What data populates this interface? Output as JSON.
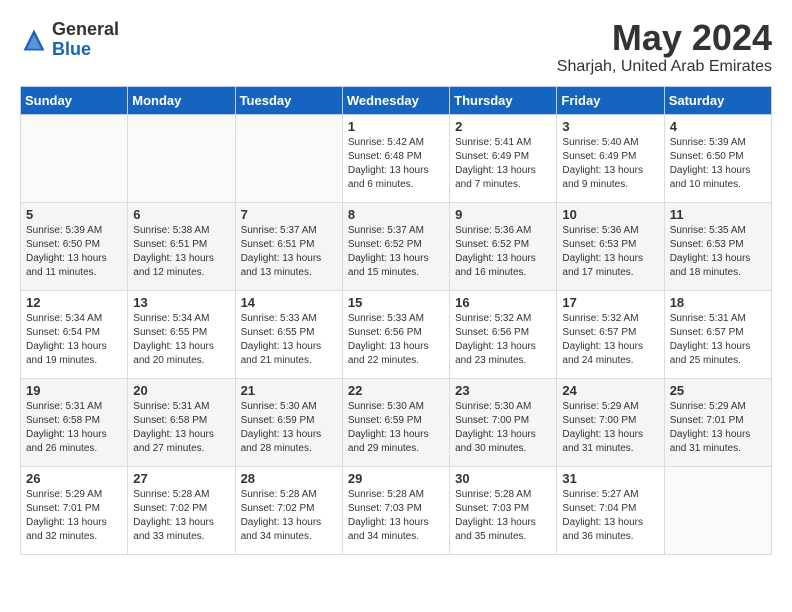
{
  "header": {
    "logo_general": "General",
    "logo_blue": "Blue",
    "month_year": "May 2024",
    "location": "Sharjah, United Arab Emirates"
  },
  "weekdays": [
    "Sunday",
    "Monday",
    "Tuesday",
    "Wednesday",
    "Thursday",
    "Friday",
    "Saturday"
  ],
  "weeks": [
    [
      {
        "day": "",
        "info": ""
      },
      {
        "day": "",
        "info": ""
      },
      {
        "day": "",
        "info": ""
      },
      {
        "day": "1",
        "info": "Sunrise: 5:42 AM\nSunset: 6:48 PM\nDaylight: 13 hours\nand 6 minutes."
      },
      {
        "day": "2",
        "info": "Sunrise: 5:41 AM\nSunset: 6:49 PM\nDaylight: 13 hours\nand 7 minutes."
      },
      {
        "day": "3",
        "info": "Sunrise: 5:40 AM\nSunset: 6:49 PM\nDaylight: 13 hours\nand 9 minutes."
      },
      {
        "day": "4",
        "info": "Sunrise: 5:39 AM\nSunset: 6:50 PM\nDaylight: 13 hours\nand 10 minutes."
      }
    ],
    [
      {
        "day": "5",
        "info": "Sunrise: 5:39 AM\nSunset: 6:50 PM\nDaylight: 13 hours\nand 11 minutes."
      },
      {
        "day": "6",
        "info": "Sunrise: 5:38 AM\nSunset: 6:51 PM\nDaylight: 13 hours\nand 12 minutes."
      },
      {
        "day": "7",
        "info": "Sunrise: 5:37 AM\nSunset: 6:51 PM\nDaylight: 13 hours\nand 13 minutes."
      },
      {
        "day": "8",
        "info": "Sunrise: 5:37 AM\nSunset: 6:52 PM\nDaylight: 13 hours\nand 15 minutes."
      },
      {
        "day": "9",
        "info": "Sunrise: 5:36 AM\nSunset: 6:52 PM\nDaylight: 13 hours\nand 16 minutes."
      },
      {
        "day": "10",
        "info": "Sunrise: 5:36 AM\nSunset: 6:53 PM\nDaylight: 13 hours\nand 17 minutes."
      },
      {
        "day": "11",
        "info": "Sunrise: 5:35 AM\nSunset: 6:53 PM\nDaylight: 13 hours\nand 18 minutes."
      }
    ],
    [
      {
        "day": "12",
        "info": "Sunrise: 5:34 AM\nSunset: 6:54 PM\nDaylight: 13 hours\nand 19 minutes."
      },
      {
        "day": "13",
        "info": "Sunrise: 5:34 AM\nSunset: 6:55 PM\nDaylight: 13 hours\nand 20 minutes."
      },
      {
        "day": "14",
        "info": "Sunrise: 5:33 AM\nSunset: 6:55 PM\nDaylight: 13 hours\nand 21 minutes."
      },
      {
        "day": "15",
        "info": "Sunrise: 5:33 AM\nSunset: 6:56 PM\nDaylight: 13 hours\nand 22 minutes."
      },
      {
        "day": "16",
        "info": "Sunrise: 5:32 AM\nSunset: 6:56 PM\nDaylight: 13 hours\nand 23 minutes."
      },
      {
        "day": "17",
        "info": "Sunrise: 5:32 AM\nSunset: 6:57 PM\nDaylight: 13 hours\nand 24 minutes."
      },
      {
        "day": "18",
        "info": "Sunrise: 5:31 AM\nSunset: 6:57 PM\nDaylight: 13 hours\nand 25 minutes."
      }
    ],
    [
      {
        "day": "19",
        "info": "Sunrise: 5:31 AM\nSunset: 6:58 PM\nDaylight: 13 hours\nand 26 minutes."
      },
      {
        "day": "20",
        "info": "Sunrise: 5:31 AM\nSunset: 6:58 PM\nDaylight: 13 hours\nand 27 minutes."
      },
      {
        "day": "21",
        "info": "Sunrise: 5:30 AM\nSunset: 6:59 PM\nDaylight: 13 hours\nand 28 minutes."
      },
      {
        "day": "22",
        "info": "Sunrise: 5:30 AM\nSunset: 6:59 PM\nDaylight: 13 hours\nand 29 minutes."
      },
      {
        "day": "23",
        "info": "Sunrise: 5:30 AM\nSunset: 7:00 PM\nDaylight: 13 hours\nand 30 minutes."
      },
      {
        "day": "24",
        "info": "Sunrise: 5:29 AM\nSunset: 7:00 PM\nDaylight: 13 hours\nand 31 minutes."
      },
      {
        "day": "25",
        "info": "Sunrise: 5:29 AM\nSunset: 7:01 PM\nDaylight: 13 hours\nand 31 minutes."
      }
    ],
    [
      {
        "day": "26",
        "info": "Sunrise: 5:29 AM\nSunset: 7:01 PM\nDaylight: 13 hours\nand 32 minutes."
      },
      {
        "day": "27",
        "info": "Sunrise: 5:28 AM\nSunset: 7:02 PM\nDaylight: 13 hours\nand 33 minutes."
      },
      {
        "day": "28",
        "info": "Sunrise: 5:28 AM\nSunset: 7:02 PM\nDaylight: 13 hours\nand 34 minutes."
      },
      {
        "day": "29",
        "info": "Sunrise: 5:28 AM\nSunset: 7:03 PM\nDaylight: 13 hours\nand 34 minutes."
      },
      {
        "day": "30",
        "info": "Sunrise: 5:28 AM\nSunset: 7:03 PM\nDaylight: 13 hours\nand 35 minutes."
      },
      {
        "day": "31",
        "info": "Sunrise: 5:27 AM\nSunset: 7:04 PM\nDaylight: 13 hours\nand 36 minutes."
      },
      {
        "day": "",
        "info": ""
      }
    ]
  ]
}
